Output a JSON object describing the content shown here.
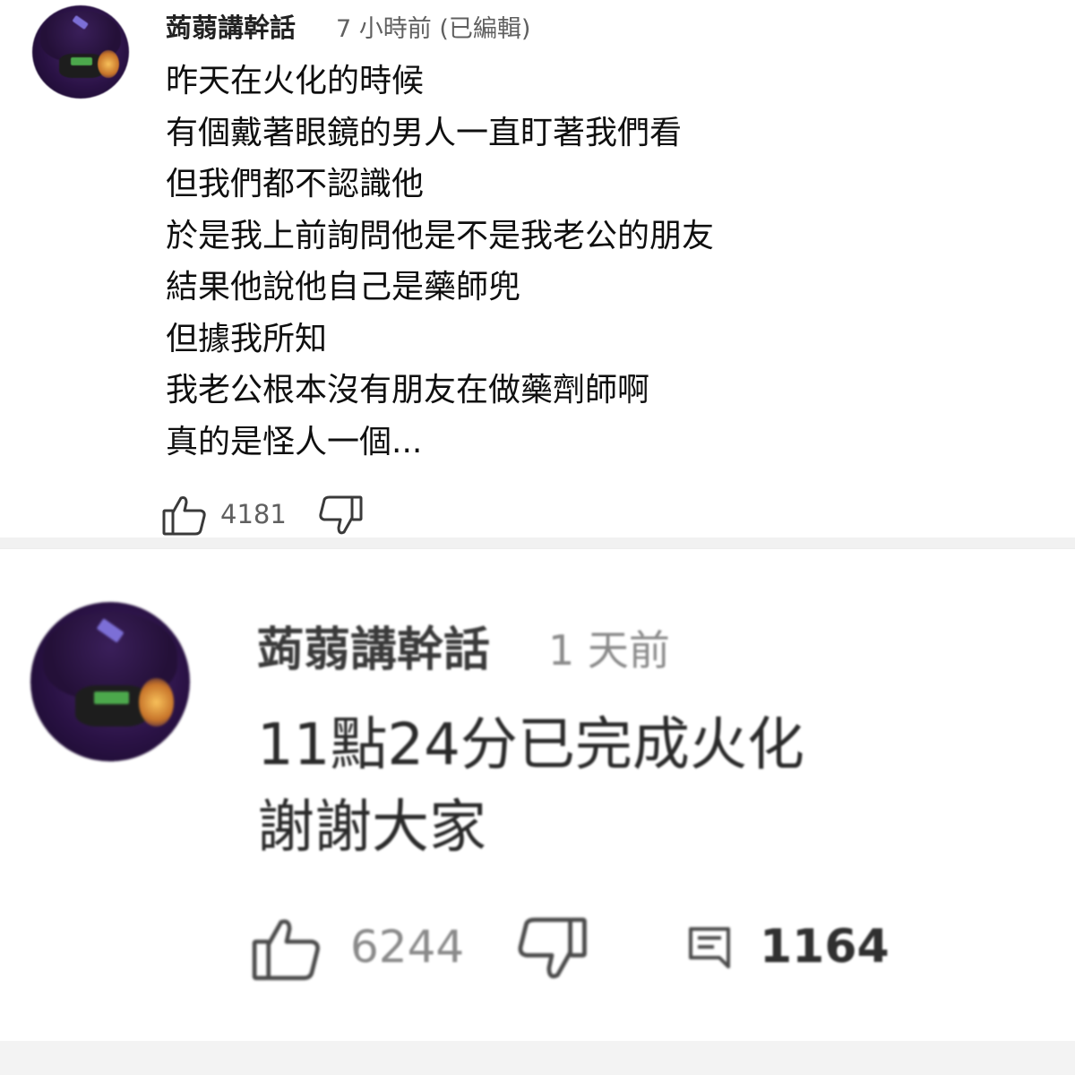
{
  "comments": [
    {
      "author": "蒟蒻講幹話",
      "time": "7 小時前 (已編輯)",
      "lines": [
        "昨天在火化的時候",
        "有個戴著眼鏡的男人一直盯著我們看",
        "但我們都不認識他",
        "於是我上前詢問他是不是我老公的朋友",
        "結果他說他自己是藥師兜",
        "但據我所知",
        "我老公根本沒有朋友在做藥劑師啊",
        "真的是怪人一個..."
      ],
      "likes": "4181",
      "icons": {
        "like": "thumbs-up-icon",
        "dislike": "thumbs-down-icon"
      }
    },
    {
      "author": "蒟蒻講幹話",
      "time": "1 天前",
      "lines": [
        "11點24分已完成火化",
        "謝謝大家"
      ],
      "likes": "6244",
      "replies": "1164",
      "icons": {
        "like": "thumbs-up-icon",
        "dislike": "thumbs-down-icon",
        "reply": "comment-icon"
      }
    }
  ],
  "colors": {
    "avatar_bg": "#2a1245",
    "avatar_accent": "#f7c05a",
    "text_primary": "#0f0f0f",
    "text_secondary": "#606060",
    "separator": "#f1f1f1"
  }
}
